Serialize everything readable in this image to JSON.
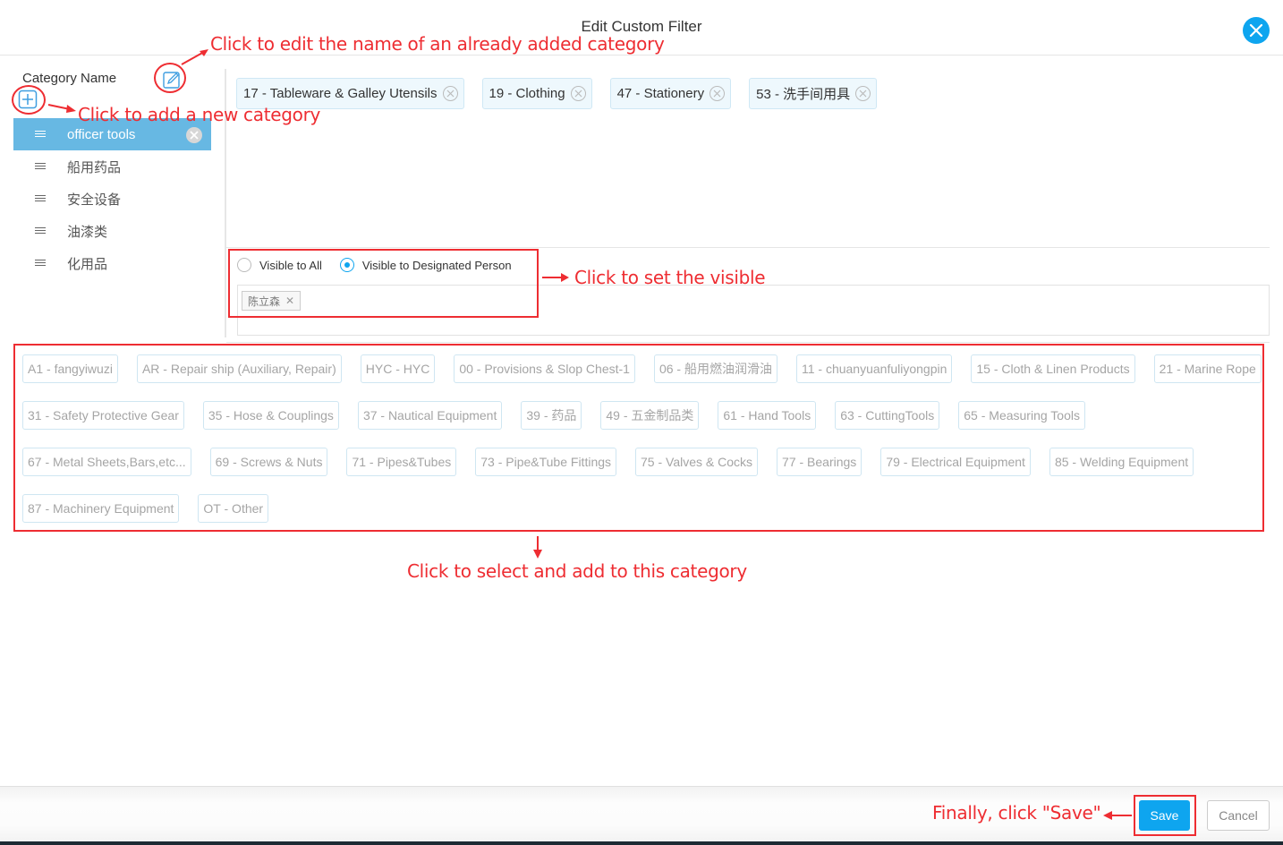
{
  "dialog": {
    "title": "Edit Custom Filter",
    "close_icon": "close-icon"
  },
  "left_panel": {
    "header_label": "Category Name",
    "edit_icon": "edit-icon",
    "add_icon": "add-icon",
    "categories": [
      {
        "label": "officer tools",
        "active": true
      },
      {
        "label": "船用药品",
        "active": false
      },
      {
        "label": "安全设备",
        "active": false
      },
      {
        "label": "油漆类",
        "active": false
      },
      {
        "label": "化用品",
        "active": false
      }
    ]
  },
  "selected_tags": [
    "17 - Tableware & Galley Utensils",
    "19 - Clothing",
    "47 - Stationery",
    "53 - 洗手间用具"
  ],
  "visibility": {
    "options": [
      "Visible to All",
      "Visible to Designated Person"
    ],
    "selected": "Visible to Designated Person",
    "persons": [
      "陈立森"
    ]
  },
  "available_tags": [
    [
      "A1 - fangyiwuzi",
      "AR - Repair ship (Auxiliary, Repair)",
      "HYC - HYC",
      "00 - Provisions & Slop Chest-1",
      "06 - 船用燃油润滑油",
      "11 - chuanyuanfuliyongpin",
      "15 - Cloth & Linen Products",
      "21 - Marine Rope"
    ],
    [
      "31 - Safety Protective Gear",
      "35 - Hose & Couplings",
      "37 - Nautical Equipment",
      "39 - 药品",
      "49 - 五金制品类",
      "61 - Hand Tools",
      "63 - CuttingTools",
      "65 - Measuring Tools"
    ],
    [
      "67 - Metal Sheets,Bars,etc...",
      "69 - Screws & Nuts",
      "71 - Pipes&Tubes",
      "73 - Pipe&Tube Fittings",
      "75 - Valves & Cocks",
      "77 - Bearings",
      "79 - Electrical Equipment",
      "85 - Welding Equipment"
    ],
    [
      "87 - Machinery Equipment",
      "OT - Other"
    ]
  ],
  "footer": {
    "save_label": "Save",
    "cancel_label": "Cancel"
  },
  "annotations": {
    "edit_name": "Click to edit the name of an already added category",
    "add_category": "Click to add a new category",
    "set_visible": "Click to set the visible",
    "select_add": "Click to select and add to this category",
    "save": "Finally, click \"Save\""
  },
  "colors": {
    "accent": "#0ea5ef",
    "active_category": "#67b8e3",
    "annotation": "#ee2d32",
    "tag_border": "#cfe6f2",
    "selected_tag_bg": "#eef8fd"
  }
}
